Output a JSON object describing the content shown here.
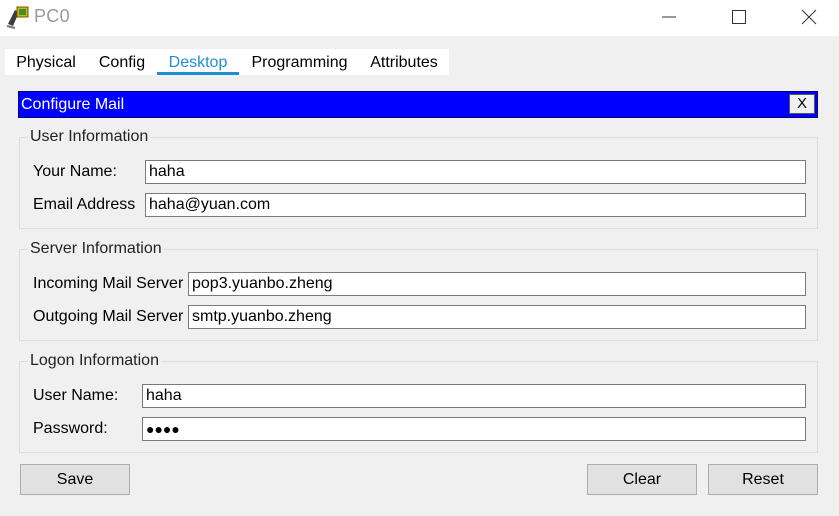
{
  "window": {
    "title": "PC0",
    "icon": "packet-tracer-pc-icon"
  },
  "tabs": [
    {
      "label": "Physical"
    },
    {
      "label": "Config"
    },
    {
      "label": "Desktop",
      "active": true
    },
    {
      "label": "Programming"
    },
    {
      "label": "Attributes"
    }
  ],
  "configure_mail": {
    "title": "Configure Mail",
    "close_label": "X",
    "header_color": "#0000ff"
  },
  "user_info": {
    "legend": "User Information",
    "your_name_label": "Your Name:",
    "your_name_value": "haha",
    "email_label": "Email Address",
    "email_value": "haha@yuan.com"
  },
  "server_info": {
    "legend": "Server Information",
    "incoming_label": "Incoming Mail Server",
    "incoming_value": "pop3.yuanbo.zheng",
    "outgoing_label": "Outgoing Mail Server",
    "outgoing_value": "smtp.yuanbo.zheng"
  },
  "logon_info": {
    "legend": "Logon Information",
    "username_label": "User Name:",
    "username_value": "haha",
    "password_label": "Password:",
    "password_value": "●●●●"
  },
  "buttons": {
    "save": "Save",
    "clear": "Clear",
    "reset": "Reset"
  },
  "colors": {
    "active_tab": "#1e8fd6"
  }
}
